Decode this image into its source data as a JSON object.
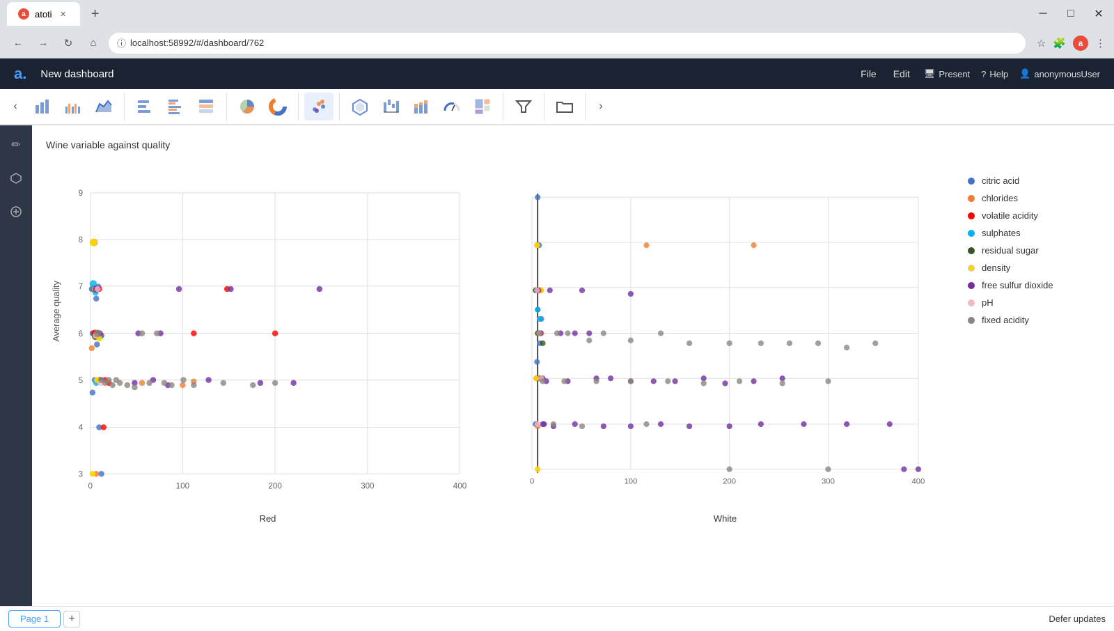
{
  "browser": {
    "tab_title": "atoti",
    "tab_favicon": "a",
    "url": "localhost:58992/#/dashboard/762",
    "new_tab_label": "+",
    "win_minimize": "─",
    "win_maximize": "□",
    "win_close": "✕"
  },
  "app": {
    "logo": "a.",
    "title": "New dashboard",
    "menu": {
      "file": "File",
      "edit": "Edit"
    },
    "actions": {
      "present_icon": "🖥",
      "present": "Present",
      "help_icon": "?",
      "help": "Help",
      "user_icon": "👤",
      "user": "anonymousUser"
    }
  },
  "chart": {
    "title": "Wine variable against quality",
    "y_axis_label": "Average quality",
    "left_x_label": "Red",
    "right_x_label": "White",
    "y_ticks": [
      3,
      4,
      5,
      6,
      7,
      8,
      9
    ],
    "x_ticks": [
      0,
      100,
      200,
      300,
      400
    ]
  },
  "legend": {
    "items": [
      {
        "label": "citric acid",
        "color": "#4472C4"
      },
      {
        "label": "chlorides",
        "color": "#ED7D31"
      },
      {
        "label": "volatile acidity",
        "color": "#FF0000"
      },
      {
        "label": "sulphates",
        "color": "#00B0F0"
      },
      {
        "label": "residual sugar",
        "color": "#375623"
      },
      {
        "label": "density",
        "color": "#FFFF00"
      },
      {
        "label": "free sulfur dioxide",
        "color": "#7030A0"
      },
      {
        "label": "pH",
        "color": "#FFB6C1"
      },
      {
        "label": "fixed acidity",
        "color": "#7F7F7F"
      }
    ]
  },
  "bottom": {
    "page_label": "Page 1",
    "add_page": "+",
    "defer_updates": "Defer updates"
  },
  "sidebar": {
    "icons": [
      "✏",
      "⬡",
      "⊕"
    ]
  }
}
